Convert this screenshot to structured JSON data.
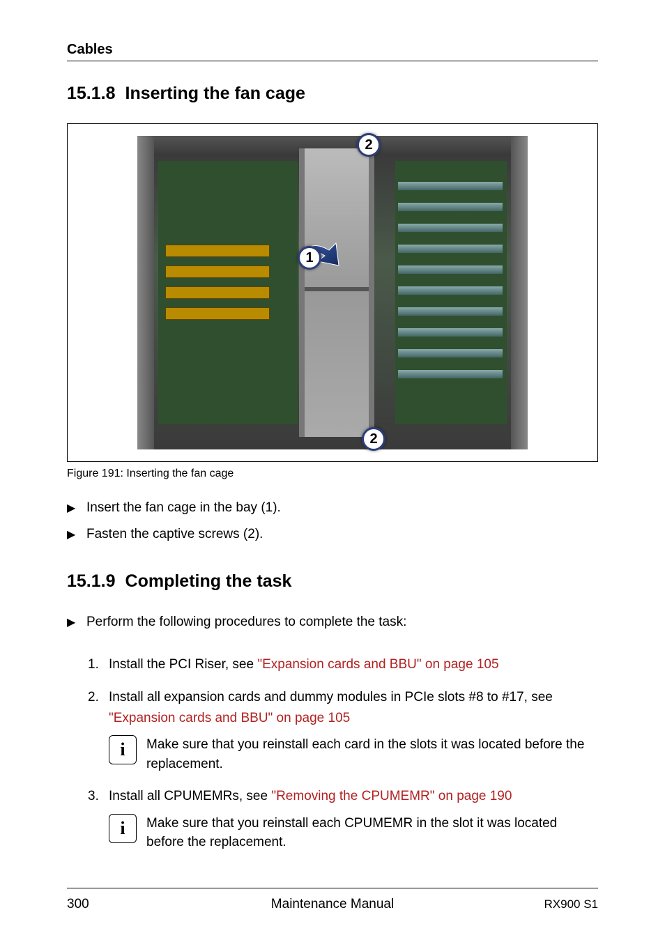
{
  "header": {
    "section_label": "Cables"
  },
  "sections": {
    "s1": {
      "number": "15.1.8",
      "title": "Inserting the fan cage"
    },
    "s2": {
      "number": "15.1.9",
      "title": "Completing the task"
    }
  },
  "figure": {
    "caption_prefix": "Figure 191: ",
    "caption_text": "Inserting the fan cage",
    "callouts": {
      "c1": "1",
      "c2a": "2",
      "c2b": "2"
    }
  },
  "s1_steps": {
    "a": "Insert the fan cage in the bay (1).",
    "b": "Fasten the captive screws (2)."
  },
  "s2_lead": "Perform the following procedures to complete the task:",
  "s2_steps": {
    "step1": {
      "num": "1.",
      "text_a": "Install the PCI Riser, see ",
      "link": "\"Expansion cards and BBU\" on page 105"
    },
    "step2": {
      "num": "2.",
      "text_a": "Install all expansion cards and dummy modules in PCIe slots #8 to #17, see ",
      "link": "\"Expansion cards and BBU\" on page 105",
      "note": "Make sure that you reinstall each card in the slots it was located before the replacement."
    },
    "step3": {
      "num": "3.",
      "text_a": "Install all CPUMEMRs, see ",
      "link": "\"Removing the CPUMEMR\" on page 190",
      "note": "Make sure that you reinstall each CPUMEMR in the slot it was located before the replacement."
    }
  },
  "footer": {
    "page": "300",
    "center": "Maintenance Manual",
    "model": "RX900 S1"
  },
  "glyphs": {
    "tri": "▶",
    "info": "i"
  }
}
